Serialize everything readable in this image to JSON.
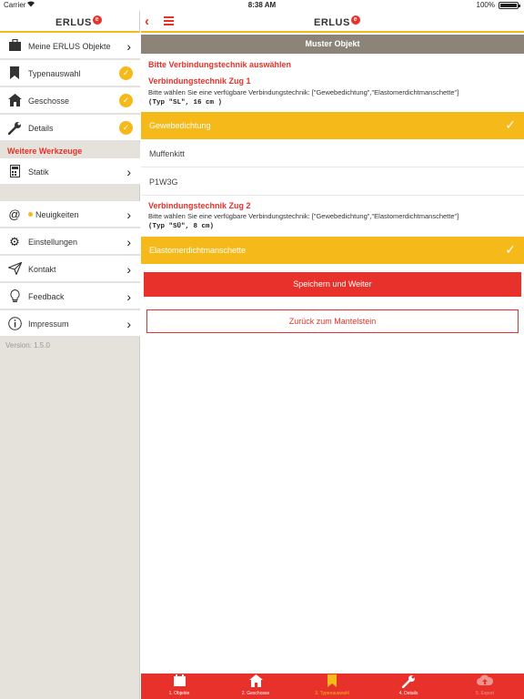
{
  "status": {
    "carrier": "Carrier",
    "wifi_icon": "wifi-icon",
    "time": "8:38 AM",
    "battery": "100%"
  },
  "brand": {
    "name": "ERLUS",
    "mark": "e"
  },
  "colors": {
    "accent": "#f5b91a",
    "brand_red": "#e8312a",
    "sidebar_bg": "#e5e1db",
    "titlebar": "#8c8479"
  },
  "sidebar": {
    "items": [
      {
        "label": "Meine ERLUS Objekte",
        "icon": "briefcase-icon",
        "state": "chevron"
      },
      {
        "label": "Typenauswahl",
        "icon": "bookmark-icon",
        "state": "checked"
      },
      {
        "label": "Geschosse",
        "icon": "house-icon",
        "state": "checked"
      },
      {
        "label": "Details",
        "icon": "wrench-icon",
        "state": "checked"
      }
    ],
    "section_title": "Weitere Werkzeuge",
    "tools": [
      {
        "label": "Statik",
        "icon": "calculator-icon"
      }
    ],
    "misc": [
      {
        "label": "Neuigkeiten",
        "icon": "at-icon",
        "has_dot": true
      },
      {
        "label": "Einstellungen",
        "icon": "gear-icon"
      },
      {
        "label": "Kontakt",
        "icon": "paper-plane-icon"
      },
      {
        "label": "Feedback",
        "icon": "lightbulb-icon"
      },
      {
        "label": "Impressum",
        "icon": "info-icon"
      }
    ],
    "version": "Version: 1.5.0"
  },
  "main": {
    "title": "Muster Objekt",
    "prompt": "Bitte Verbindungstechnik auswählen",
    "groups": [
      {
        "title": "Verbindungstechnik Zug 1",
        "description": "Bitte wählen Sie eine verfügbare Verbindungstechnik: [\"Gewebedichtung\",\"Elastomerdichtmanschette\"]",
        "type": "(Typ \"SL\", 16 cm )",
        "options": [
          {
            "label": "Gewebedichtung",
            "selected": true
          },
          {
            "label": "Muffenkitt",
            "selected": false
          },
          {
            "label": "P1W3G",
            "selected": false
          }
        ]
      },
      {
        "title": "Verbindungstechnik Zug 2",
        "description": "Bitte wählen Sie eine verfügbare Verbindungstechnik: [\"Gewebedichtung\",\"Elastomerdichtmanschette\"]",
        "type": "(Typ \"SÜ\", 8 cm)",
        "options": [
          {
            "label": "Elastomerdichtmanschette",
            "selected": true
          }
        ]
      }
    ],
    "save_button": "Speichern und Weiter",
    "back_button": "Zurück zum Mantelstein"
  },
  "tabbar": {
    "tabs": [
      {
        "label": "1. Objekte",
        "icon": "calendar-icon",
        "state": "normal"
      },
      {
        "label": "2. Geschosse",
        "icon": "house-icon",
        "state": "normal"
      },
      {
        "label": "3. Typenauswahl",
        "icon": "bookmark-icon",
        "state": "active"
      },
      {
        "label": "4. Details",
        "icon": "wrench-icon",
        "state": "normal"
      },
      {
        "label": "5. Export",
        "icon": "cloud-upload-icon",
        "state": "disabled"
      }
    ]
  }
}
